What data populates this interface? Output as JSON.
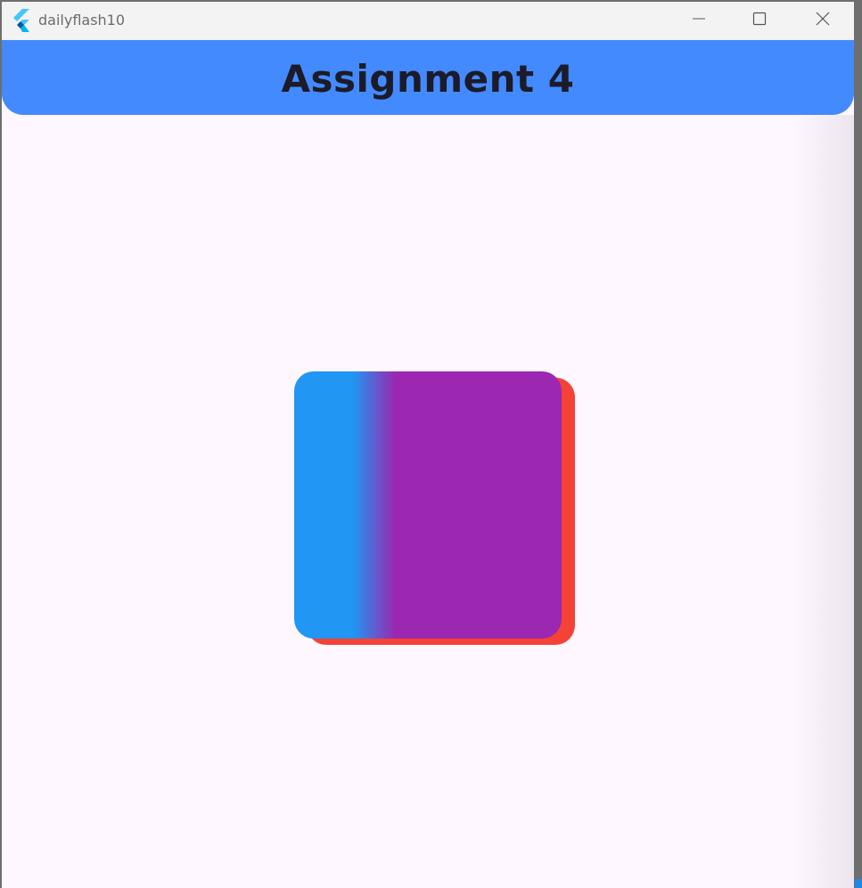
{
  "window": {
    "title": "dailyflash10",
    "app_icon": "flutter-logo-icon",
    "controls": [
      "minimize-icon",
      "maximize-icon",
      "close-icon"
    ]
  },
  "appbar": {
    "title": "Assignment 4",
    "color": "#448aff"
  },
  "card": {
    "gradient_colors": [
      "#2196f3",
      "#9c27b0"
    ],
    "shadow_color": "#f44336"
  },
  "background_color": "#fef7ff"
}
